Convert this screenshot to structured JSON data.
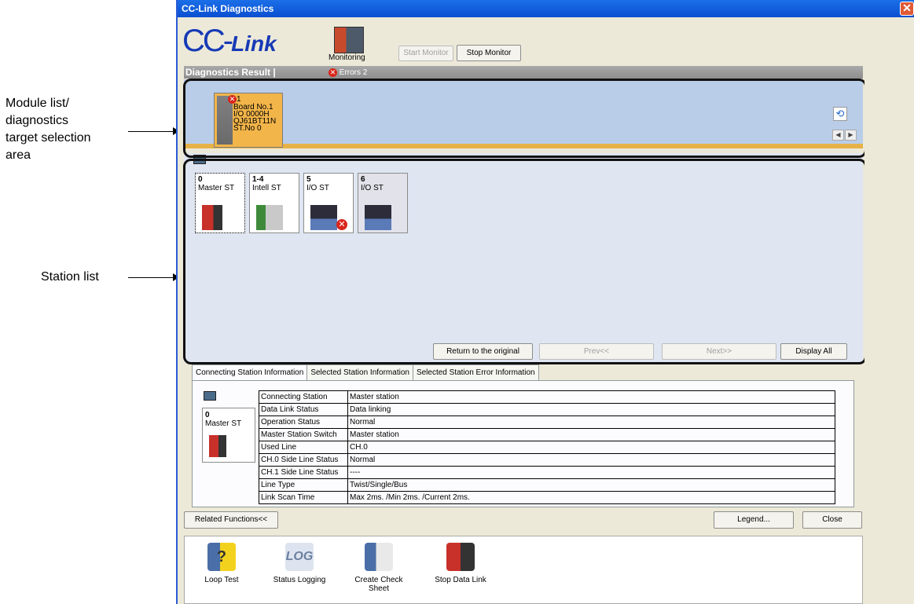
{
  "annotations": {
    "module_list_lines": [
      "Module list/",
      "diagnostics",
      "target selection",
      "area"
    ],
    "station_list": "Station list"
  },
  "window": {
    "title": "CC-Link Diagnostics",
    "close": "✕"
  },
  "logo": {
    "prefix": "CC-",
    "suffix": "Link"
  },
  "toolbar": {
    "monitoring_label": "Monitoring",
    "start_monitor": "Start Monitor",
    "stop_monitor": "Stop Monitor"
  },
  "diagnostics": {
    "title": "Diagnostics Result |",
    "errors_label": "Errors 2",
    "error_x": "✕"
  },
  "module": {
    "error_count": "1",
    "lines": [
      "Board No.1",
      "I/O 0000H",
      "QJ61BT11N",
      "ST.No 0"
    ]
  },
  "stations": [
    {
      "num": "0",
      "label": "Master ST"
    },
    {
      "num": "1-4",
      "label": "Intell ST"
    },
    {
      "num": "5",
      "label": "I/O ST"
    },
    {
      "num": "6",
      "label": "I/O ST"
    }
  ],
  "station_buttons": {
    "return": "Return to the original",
    "prev": "Prev<<",
    "next": "Next>>",
    "display_all": "Display All"
  },
  "tabs": [
    "Connecting Station Information",
    "Selected Station Information",
    "Selected Station Error Information"
  ],
  "connecting_station": {
    "num": "0",
    "label": "Master ST"
  },
  "info_rows": [
    {
      "k": "Connecting Station",
      "v": "Master station"
    },
    {
      "k": "Data Link Status",
      "v": "Data linking"
    },
    {
      "k": "Operation Status",
      "v": "Normal"
    },
    {
      "k": "Master Station Switch",
      "v": "Master station"
    },
    {
      "k": "Used Line",
      "v": "CH.0"
    },
    {
      "k": "CH.0 Side Line Status",
      "v": "Normal"
    },
    {
      "k": "CH.1 Side Line Status",
      "v": "----"
    },
    {
      "k": "Line Type",
      "v": "Twist/Single/Bus"
    },
    {
      "k": "Link Scan Time",
      "v": "Max 2ms. /Min 2ms. /Current 2ms."
    }
  ],
  "bottom_buttons": {
    "related": "Related Functions<<",
    "legend": "Legend...",
    "close": "Close"
  },
  "functions": [
    "Loop Test",
    "Status Logging",
    "Create Check Sheet",
    "Stop Data Link"
  ],
  "function_icon_text": {
    "log": "LOG",
    "question": "?"
  },
  "icons": {
    "refresh": "⟲",
    "left": "◀",
    "right": "▶"
  },
  "colors": {
    "title_bar": "#0a4fd0",
    "module_area": "#b9cde9",
    "station_area": "#dfe6f2",
    "module_card": "#f2b54a",
    "error": "#d9261c"
  }
}
